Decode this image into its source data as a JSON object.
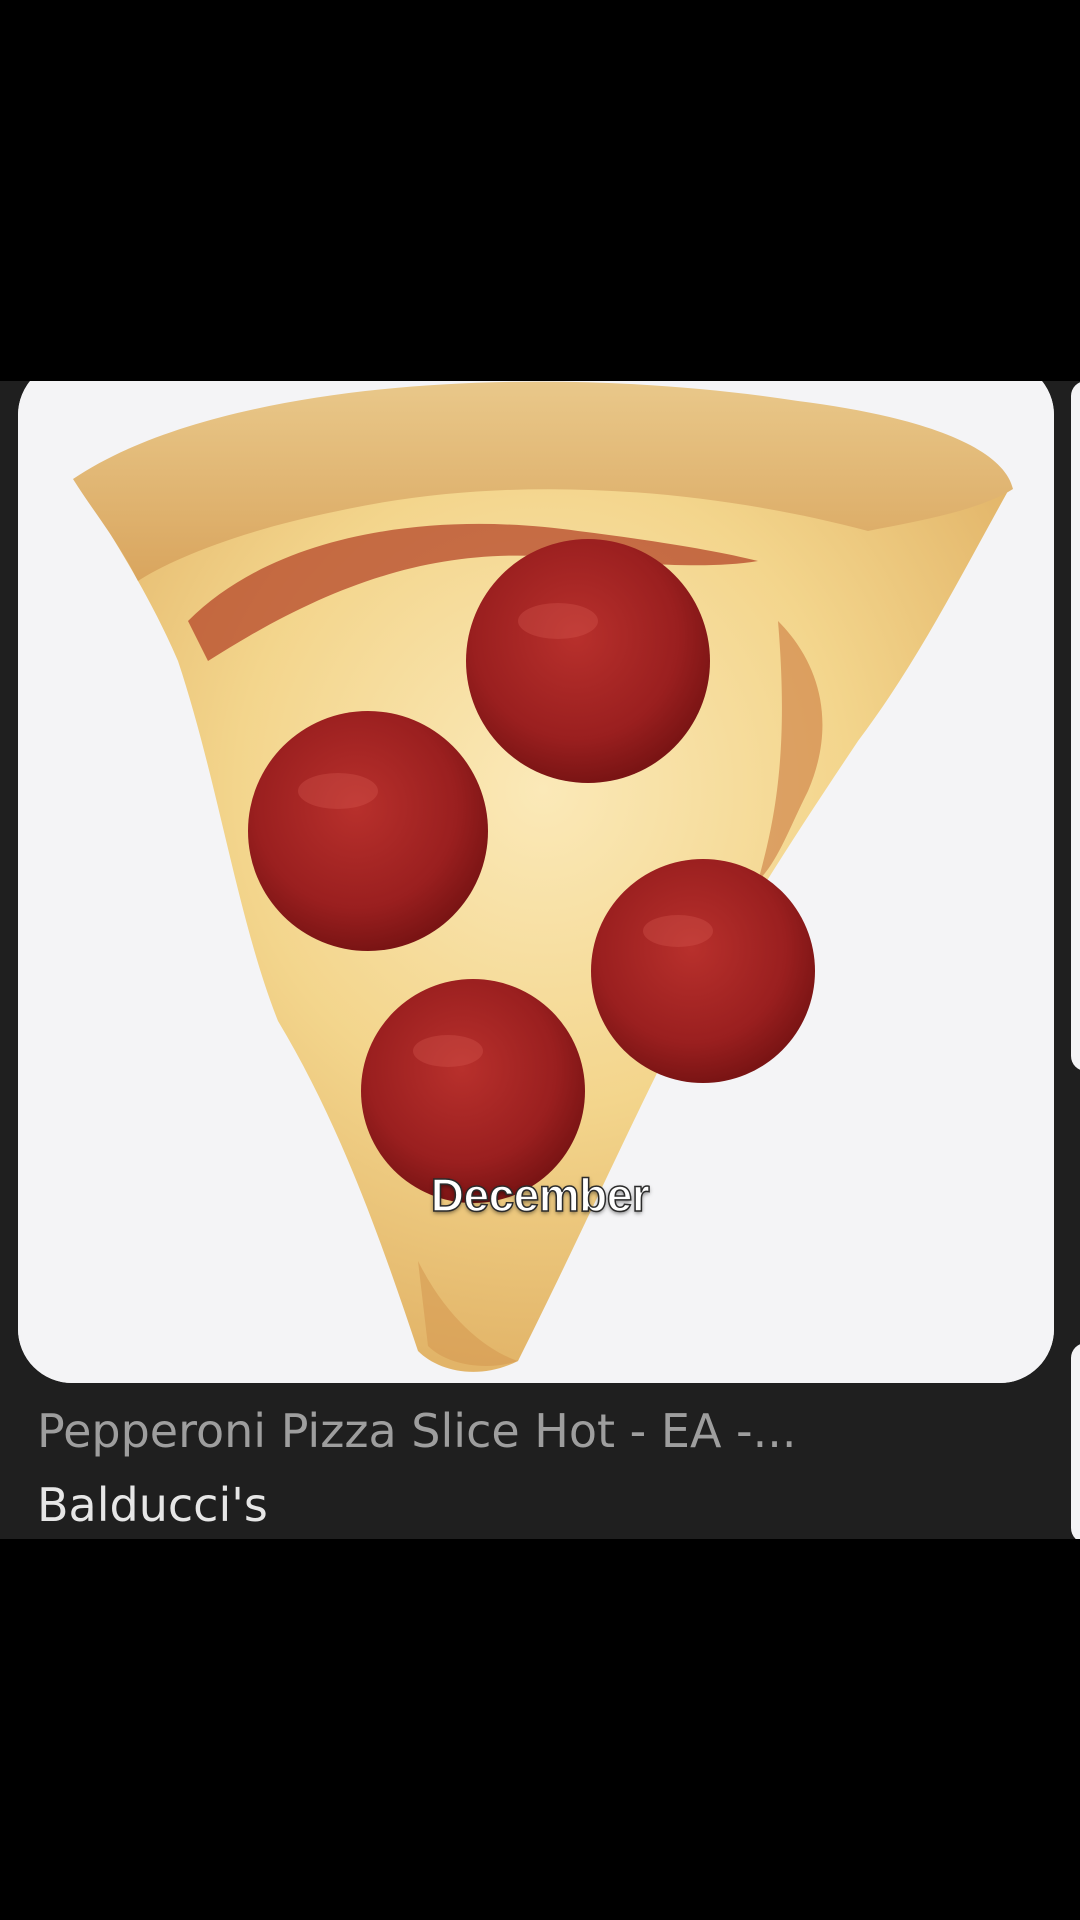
{
  "result": {
    "title": "Pepperoni Pizza Slice Hot - EA -...",
    "source": "Balducci's",
    "image_subject": "pepperoni-pizza-slice"
  },
  "caption": "December",
  "colors": {
    "page_background": "#000000",
    "panel_background": "#1f1f1f",
    "card_background": "#f4f4f6",
    "title_color": "#9e9e9e",
    "source_color": "#e6e6e6",
    "caption_color": "#ffffff"
  }
}
